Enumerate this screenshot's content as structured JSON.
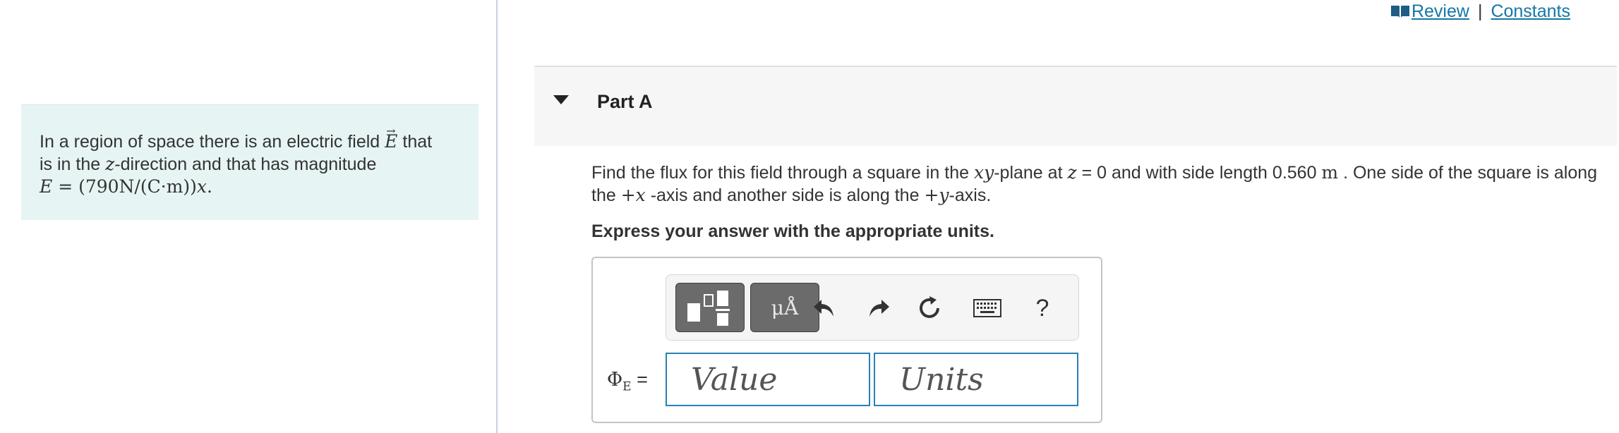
{
  "intro": {
    "line1_a": "In a region of space there is an electric field ",
    "field_symbol": "E",
    "line1_b": " that",
    "line2_a": "is in the ",
    "z_var": "z",
    "line2_b": "-direction and that has magnitude",
    "line3_lhs": "E",
    "line3_eq": " = (790N/(C·m))",
    "line3_x": "x",
    "line3_end": "."
  },
  "header": {
    "review_label": "Review",
    "separator": "|",
    "constants_label": "Constants"
  },
  "part": {
    "title": "Part A"
  },
  "question": {
    "t1": "Find the flux for this field through a square in the ",
    "xy": "xy",
    "t2": "-plane at ",
    "z": "z",
    "t3": " = 0 and with side length 0.560 ",
    "unit_m": "m",
    "t4": " . One side of the square is along the ",
    "plus_x": "+x",
    "t5": " -axis and another side is along the ",
    "plus_y": "+y",
    "t6": "-axis."
  },
  "instruction": "Express your answer with the appropriate units.",
  "toolbar": {
    "symbols_label": "μÅ",
    "help_label": "?",
    "icons": [
      "templates-icon",
      "undo-icon",
      "redo-icon",
      "reset-icon",
      "keyboard-icon"
    ]
  },
  "answer": {
    "phi_symbol": "Φ",
    "phi_sub": "E",
    "equals": " =",
    "value_placeholder": "Value",
    "units_placeholder": "Units"
  },
  "colors": {
    "link": "#1477a6",
    "intro_bg": "#e6f5f4",
    "input_border": "#2a80b9",
    "part_bg": "#f6f6f6"
  }
}
